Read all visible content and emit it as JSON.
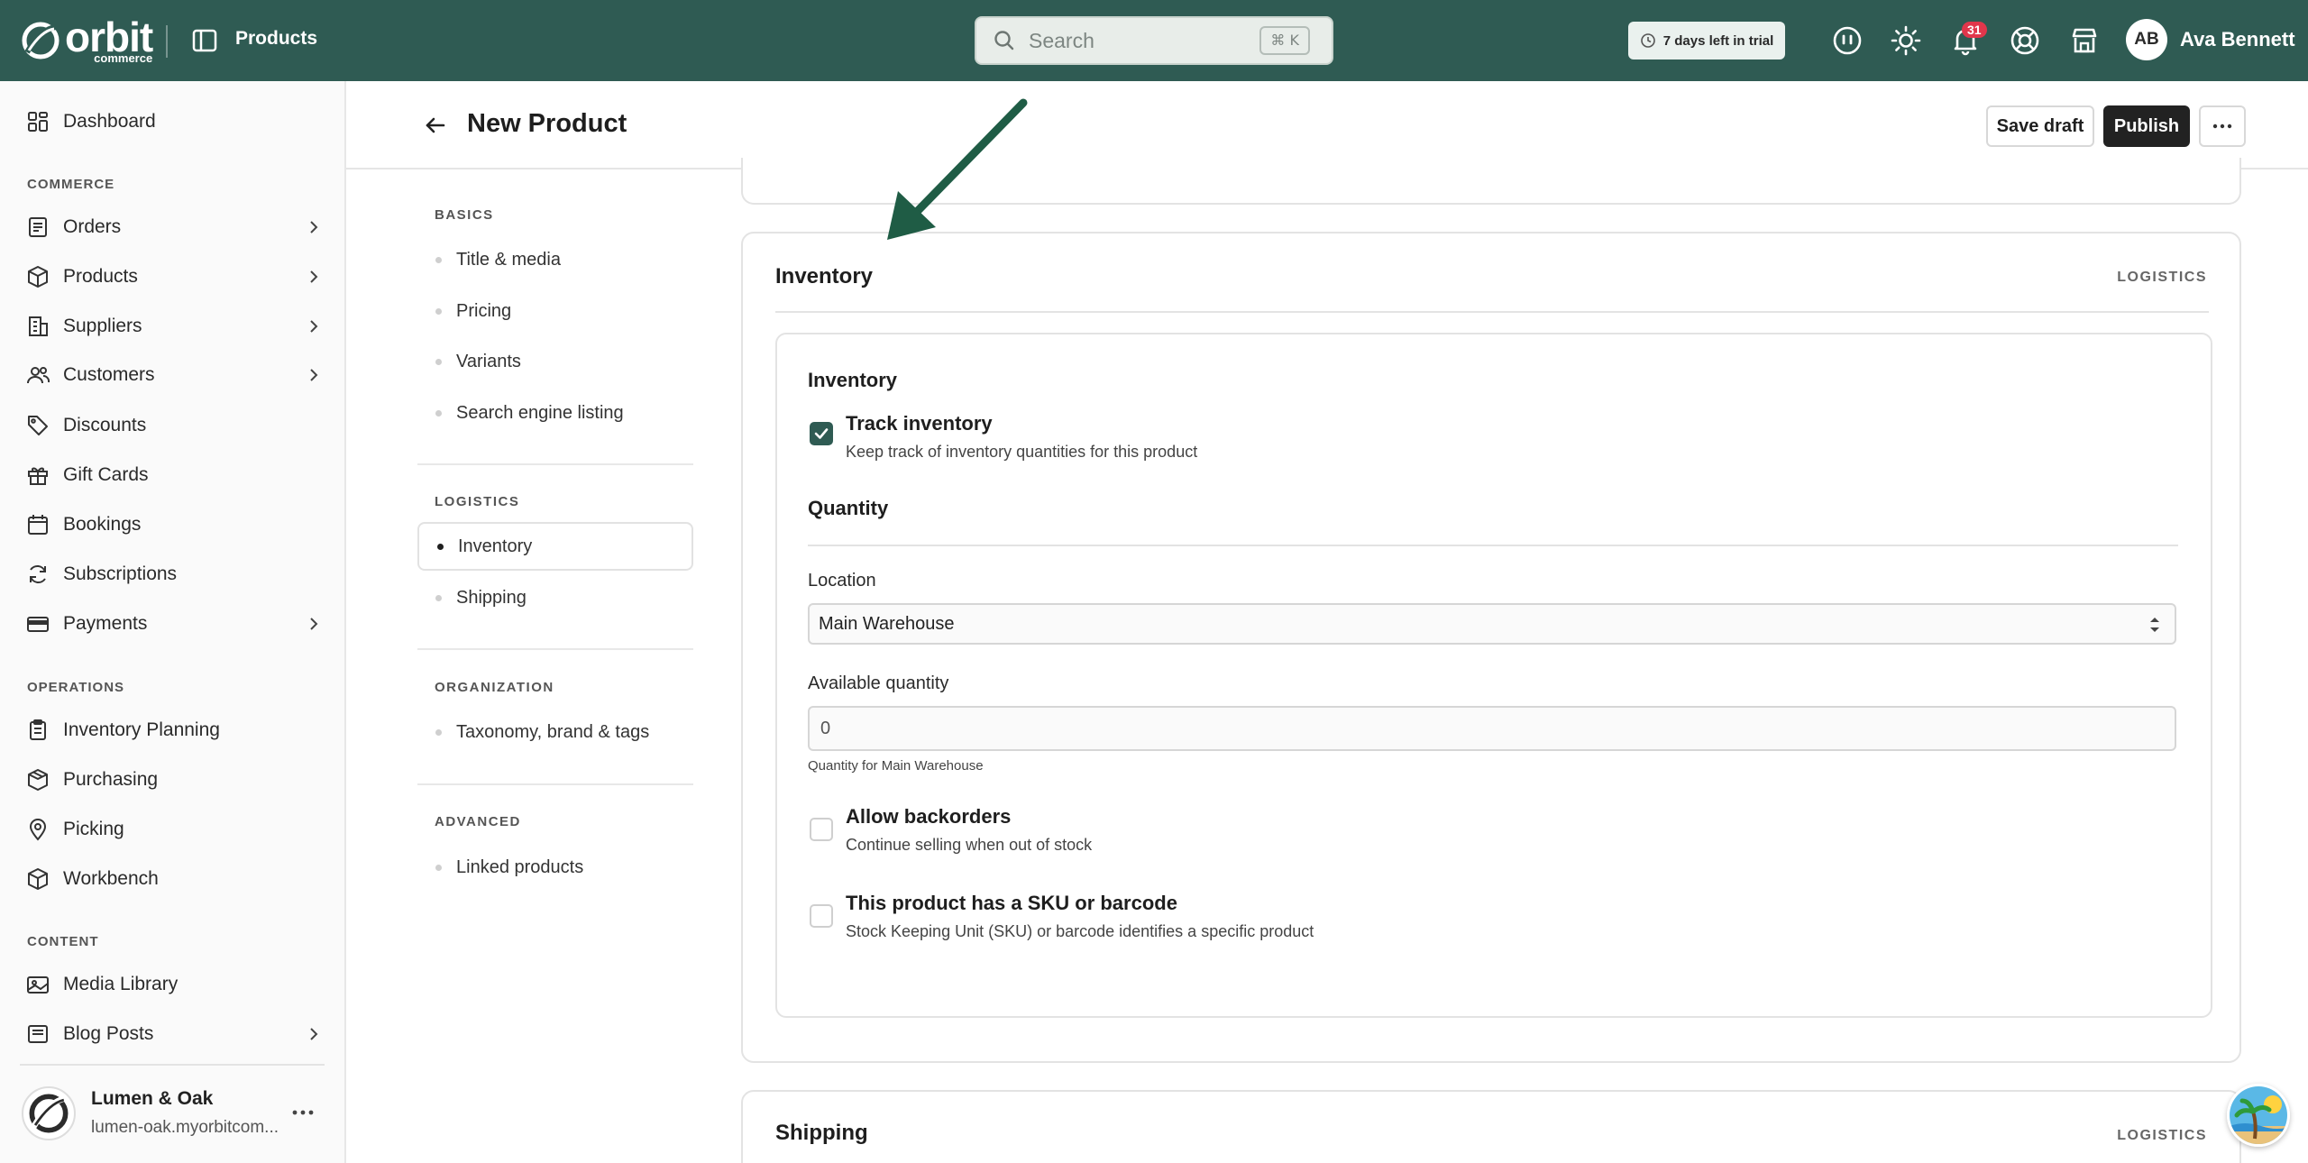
{
  "topbar": {
    "logo_text": "orbit",
    "logo_sub": "commerce",
    "section": "Products",
    "search_placeholder": "Search",
    "search_shortcut": "⌘ K",
    "trial_text": "7 days left in trial",
    "notifications_count": "31",
    "avatar_initials": "AB",
    "user_name": "Ava Bennett"
  },
  "sidebar": {
    "items": [
      {
        "label": "Dashboard"
      },
      {
        "label": "Orders"
      },
      {
        "label": "Products"
      },
      {
        "label": "Suppliers"
      },
      {
        "label": "Customers"
      },
      {
        "label": "Discounts"
      },
      {
        "label": "Gift Cards"
      },
      {
        "label": "Bookings"
      },
      {
        "label": "Subscriptions"
      },
      {
        "label": "Payments"
      },
      {
        "label": "Inventory Planning"
      },
      {
        "label": "Purchasing"
      },
      {
        "label": "Picking"
      },
      {
        "label": "Workbench"
      },
      {
        "label": "Media Library"
      },
      {
        "label": "Blog Posts"
      }
    ],
    "headings": {
      "commerce": "COMMERCE",
      "operations": "OPERATIONS",
      "content": "CONTENT"
    },
    "store": {
      "name": "Lumen & Oak",
      "url": "lumen-oak.myorbitcom..."
    }
  },
  "header": {
    "title": "New Product",
    "save_draft": "Save draft",
    "publish": "Publish"
  },
  "section_nav": {
    "basics_heading": "BASICS",
    "basics": [
      "Title & media",
      "Pricing",
      "Variants",
      "Search engine listing"
    ],
    "logistics_heading": "LOGISTICS",
    "logistics": [
      "Inventory",
      "Shipping"
    ],
    "organization_heading": "ORGANIZATION",
    "organization": [
      "Taxonomy, brand & tags"
    ],
    "advanced_heading": "ADVANCED",
    "advanced": [
      "Linked products"
    ]
  },
  "inventory_card": {
    "title": "Inventory",
    "tag": "LOGISTICS",
    "sub_title": "Inventory",
    "track_title": "Track inventory",
    "track_desc": "Keep track of inventory quantities for this product",
    "track_checked": true,
    "quantity_heading": "Quantity",
    "location_label": "Location",
    "location_value": "Main Warehouse",
    "available_label": "Available quantity",
    "available_value": "0",
    "available_hint": "Quantity for Main Warehouse",
    "backorders_title": "Allow backorders",
    "backorders_desc": "Continue selling when out of stock",
    "backorders_checked": false,
    "sku_title": "This product has a SKU or barcode",
    "sku_desc": "Stock Keeping Unit (SKU) or barcode identifies a specific product",
    "sku_checked": false
  },
  "shipping_card": {
    "title": "Shipping",
    "tag": "LOGISTICS"
  },
  "colors": {
    "brand": "#2f5b53",
    "badge": "#e1364b",
    "arrow": "#1f5c45"
  }
}
